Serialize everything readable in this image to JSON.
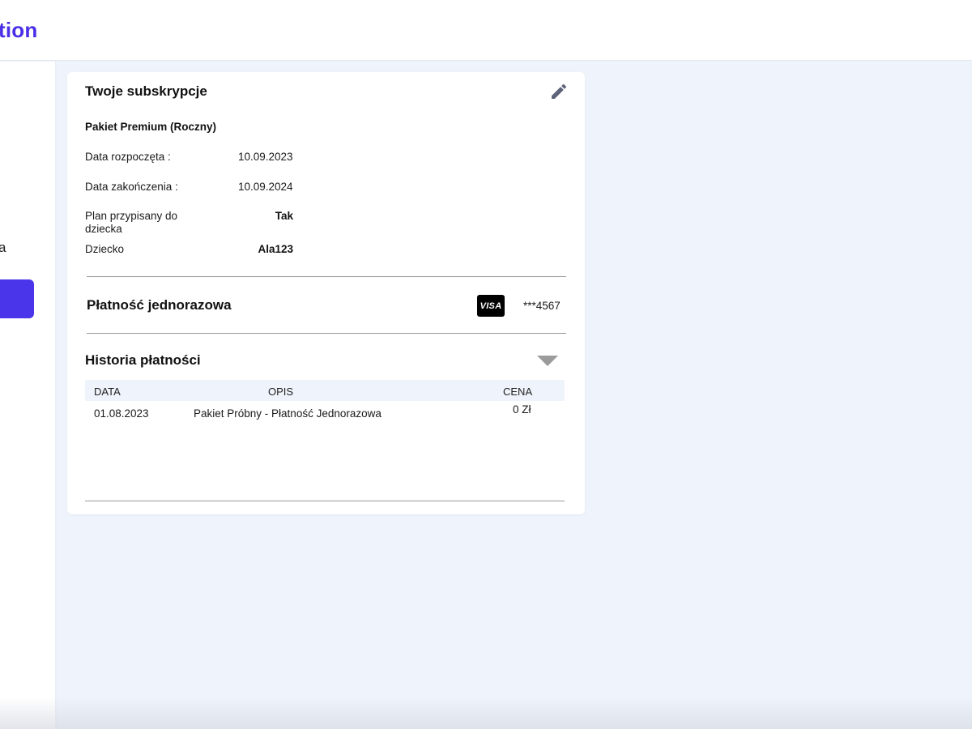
{
  "header": {
    "logo_text": "tion"
  },
  "sidebar": {
    "fragment_text": "a"
  },
  "subscription": {
    "title": "Twoje subskrypcje",
    "plan_name": "Pakiet Premium (Roczny)",
    "rows": [
      {
        "label": "Data rozpoczęta :",
        "value": "10.09.2023"
      },
      {
        "label": "Data zakończenia :",
        "value": "10.09.2024"
      },
      {
        "label": "Plan przypisany do dziecka",
        "value": "Tak"
      },
      {
        "label": "Dziecko",
        "value": "Ala123"
      }
    ]
  },
  "payment": {
    "title": "Płatność jednorazowa",
    "card_brand": "VISA",
    "card_number": "***4567"
  },
  "history": {
    "title": "Historia płatności",
    "columns": {
      "date": "DATA",
      "description": "OPIS",
      "price": "CENA"
    },
    "rows": [
      {
        "date": "01.08.2023",
        "description": "Pakiet Próbny - Płatność Jednorazowa",
        "price": "0 Zł"
      }
    ]
  },
  "colors": {
    "accent": "#4a35ea",
    "background": "#eff3fb",
    "card": "#ffffff"
  },
  "icons": {
    "edit": "pencil-icon",
    "expand": "chevron-down-icon"
  }
}
